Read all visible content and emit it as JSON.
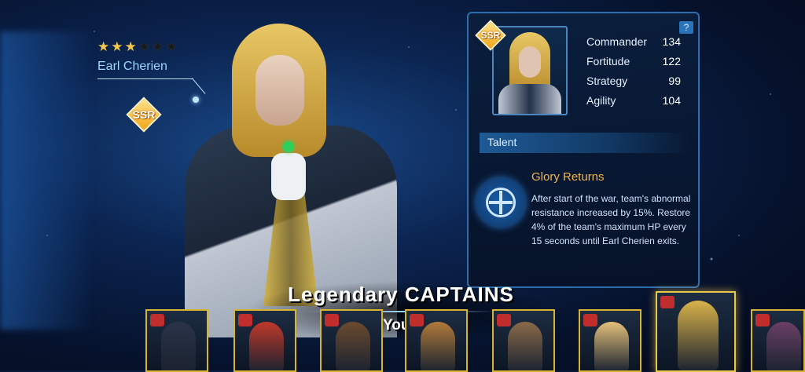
{
  "captain": {
    "name": "Earl Cherien",
    "stars_total": 6,
    "stars_filled": 3,
    "rarity": "SSR"
  },
  "panel": {
    "help": "?",
    "rarity": "SSR",
    "stats": [
      {
        "label": "Commander",
        "value": "134"
      },
      {
        "label": "Fortitude",
        "value": "122"
      },
      {
        "label": "Strategy",
        "value": "99"
      },
      {
        "label": "Agility",
        "value": "104"
      }
    ],
    "talent_header": "Talent",
    "talent_name": "Glory Returns",
    "talent_icon": "cross-ring-icon",
    "talent_desc": "After start of the war, team's abnormal resistance increased by 15%. Restore 4% of the team's maximum HP every 15 seconds until Earl Cherien exits."
  },
  "banner": {
    "headline": "Legendary CAPTAINS",
    "subline": "Lead Your Team"
  },
  "roster": [
    {
      "badge": "",
      "color": "#2a3348"
    },
    {
      "badge": "",
      "color": "#c0392b"
    },
    {
      "badge": "",
      "color": "#6b4a2e"
    },
    {
      "badge": "",
      "color": "#b07a3a"
    },
    {
      "badge": "",
      "color": "#8a6a4a"
    },
    {
      "badge": "",
      "color": "#e3c07a"
    },
    {
      "badge": "",
      "color": "#d9b24a",
      "active": true
    },
    {
      "badge": "",
      "color": "#6b3f66"
    }
  ]
}
